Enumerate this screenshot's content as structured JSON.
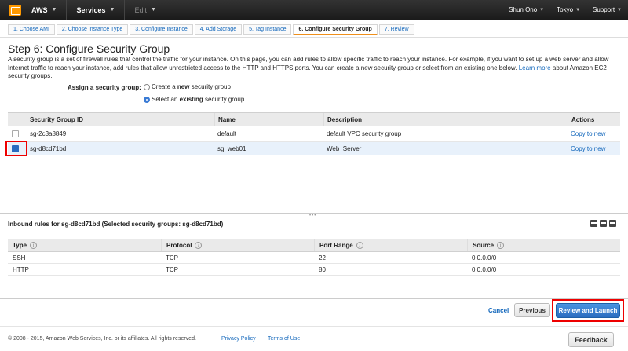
{
  "topnav": {
    "brand": "AWS",
    "services": "Services",
    "edit": "Edit",
    "user": "Shun Ono",
    "region": "Tokyo",
    "support": "Support"
  },
  "steps": [
    "1. Choose AMI",
    "2. Choose Instance Type",
    "3. Configure Instance",
    "4. Add Storage",
    "5. Tag Instance",
    "6. Configure Security Group",
    "7. Review"
  ],
  "page": {
    "title": "Step 6: Configure Security Group",
    "description": "A security group is a set of firewall rules that control the traffic for your instance. On this page, you can add rules to allow specific traffic to reach your instance. For example, if you want to set up a web server and allow Internet traffic to reach your instance, add rules that allow unrestricted access to the HTTP and HTTPS ports. You can create a new security group or select from an existing one below.",
    "learn_more": "Learn more",
    "description_tail": "about Amazon EC2 security groups."
  },
  "assign": {
    "label": "Assign a security group:",
    "option_new_pre": "Create a ",
    "option_new_bold": "new",
    "option_new_post": " security group",
    "option_existing_pre": "Select an ",
    "option_existing_bold": "existing",
    "option_existing_post": " security group"
  },
  "sg_table": {
    "headers": {
      "id": "Security Group ID",
      "name": "Name",
      "description": "Description",
      "actions": "Actions"
    },
    "rows": [
      {
        "id": "sg-2c3a8849",
        "name": "default",
        "description": "default VPC security group",
        "action": "Copy to new"
      },
      {
        "id": "sg-d8cd71bd",
        "name": "sg_web01",
        "description": "Web_Server",
        "action": "Copy to new"
      }
    ]
  },
  "inbound": {
    "title": "Inbound rules for sg-d8cd71bd (Selected security groups: sg-d8cd71bd)",
    "headers": {
      "type": "Type",
      "protocol": "Protocol",
      "port": "Port Range",
      "source": "Source"
    },
    "rows": [
      {
        "type": "SSH",
        "protocol": "TCP",
        "port": "22",
        "source": "0.0.0.0/0"
      },
      {
        "type": "HTTP",
        "protocol": "TCP",
        "port": "80",
        "source": "0.0.0.0/0"
      }
    ]
  },
  "actions": {
    "cancel": "Cancel",
    "previous": "Previous",
    "review_launch": "Review and Launch"
  },
  "footer": {
    "copyright": "© 2008 - 2015, Amazon Web Services, Inc. or its affiliates. All rights reserved.",
    "privacy": "Privacy Policy",
    "terms": "Terms of Use",
    "feedback": "Feedback"
  }
}
